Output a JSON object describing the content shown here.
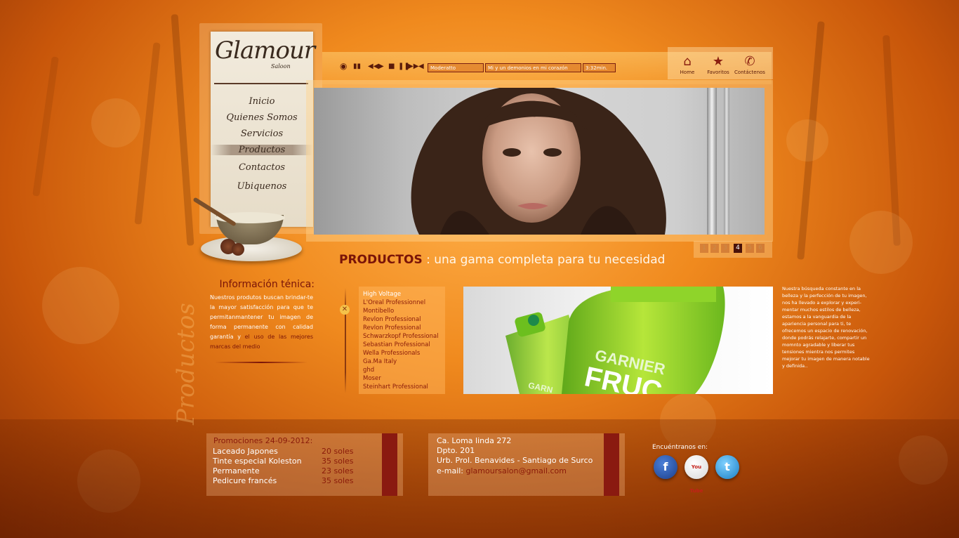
{
  "brand": {
    "logo": "Glamour",
    "sub": "Saloon"
  },
  "menu": [
    "Inicio",
    "Quienes Somos",
    "Servicios",
    "Productos",
    "Contactos",
    "Ubiquenos"
  ],
  "player": {
    "genre": "Moderatto",
    "track": "Mi y un demonios en mi corazón",
    "time": "3:32min."
  },
  "topnav": [
    {
      "label": "Home",
      "icon": "home-icon"
    },
    {
      "label": "Favoritos",
      "icon": "star-icon"
    },
    {
      "label": "Contáctenos",
      "icon": "phone-icon"
    }
  ],
  "pager": [
    "1",
    "2",
    "3",
    "4",
    "5",
    "6"
  ],
  "section": {
    "em": "PRODUCTOS",
    "rest": " : una gama completa para tu necesidad"
  },
  "info": {
    "title": "Información ténica:",
    "text": "Nuestros produtos buscan brindar-te la mayor satisfacción para que te permitanmantener tu imagen de forma permanente con calidad garantía y ",
    "highlight": "el uso de las mejores marcas del medio",
    "vertical": "Productos"
  },
  "brands": [
    "High Voltage",
    "L'Oreal Professionnel",
    "Montibello",
    "Revlon Professional",
    "Revlon Professional",
    "Schwarzkopf Professional",
    "Sebastian Professional",
    "Wella Professionals",
    "Ga.Ma Italy",
    "ghd",
    "Moser",
    "Steinhart Professional"
  ],
  "product": {
    "brand_text": "GARNIER",
    "line_text": "FRUC",
    "small_text": "GARN"
  },
  "description": "Nuestra búsqueda constante en la belleza y la perfección de tu imagen, nos ha llevado a explorar y experi-mentar muchos estilos de belleza, estamos a la vanguardia de la apariencia personal para ti, te ofrecemos un espacio de renovación, donde podrás relajarte, compartir un momnto agradable y liberar tus tensiones mientra nos permites mejorar tu imagen de manera notable y definida..",
  "promo": {
    "title": "Promociones 24-09-2012:",
    "items": [
      {
        "name": "Laceado Japones",
        "price": "20 soles"
      },
      {
        "name": "Tinte especial Koleston",
        "price": "35 soles"
      },
      {
        "name": "Permanente",
        "price": "23 soles"
      },
      {
        "name": "Pedicure francés",
        "price": "35 soles"
      }
    ]
  },
  "address": {
    "line1": "Ca. Loma linda 272",
    "line2": "Dpto. 201",
    "line3": "Urb. Prol. Benavides - Santiago de Surco",
    "email_label": "e-mail: ",
    "email": "glamoursalon@gmail.com"
  },
  "social": {
    "label": "Encuéntranos en:",
    "youtube": "You Tube",
    "facebook": "f",
    "twitter": "t"
  },
  "colors": {
    "accent": "#7a1408",
    "orange": "#f08a1e",
    "cream": "#f2ebdd"
  }
}
